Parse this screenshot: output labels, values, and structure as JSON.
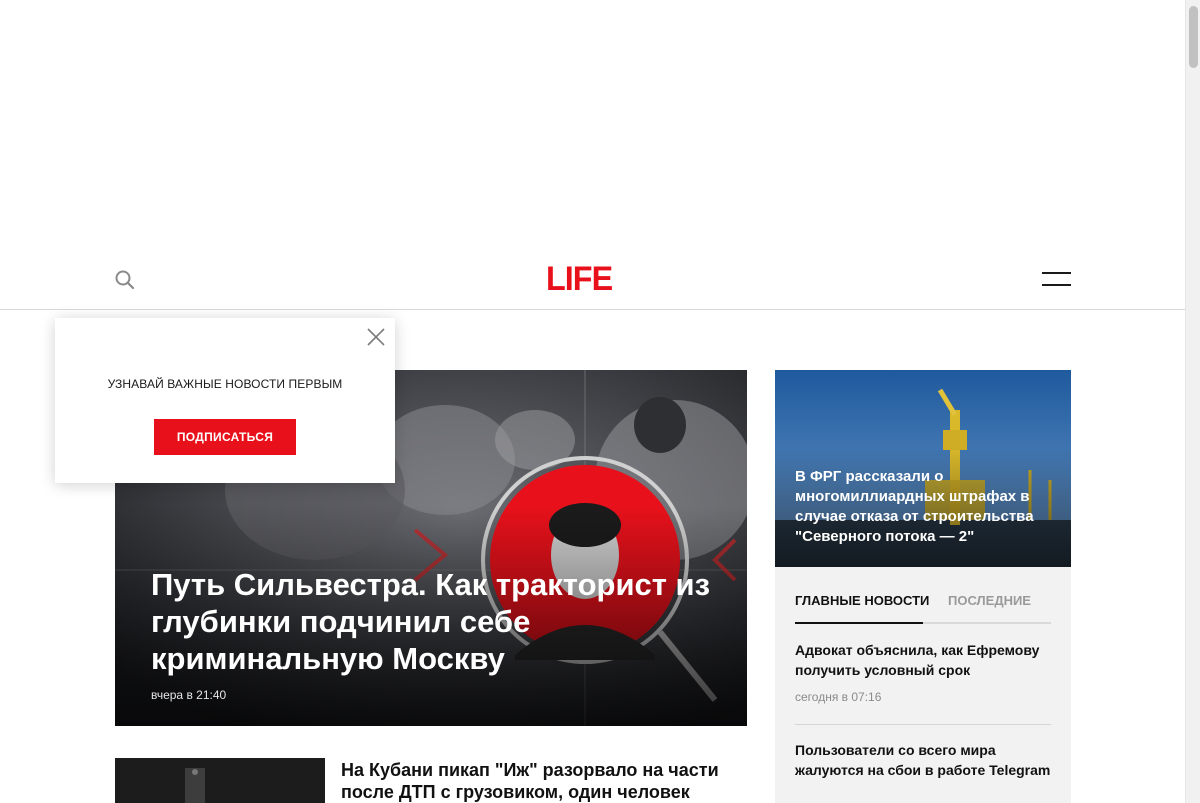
{
  "header": {
    "logo_text": "LIFE",
    "search_icon": "search-icon",
    "menu_icon": "hamburger-menu-icon"
  },
  "hero": {
    "title": "Путь Сильвестра. Как тракторист из глубинки подчинил себе криминальную Москву",
    "time": "вчера в 21:40"
  },
  "news_list": [
    {
      "title": "На Кубани пикап \"Иж\" разорвало на части после ДТП с грузовиком, один человек"
    }
  ],
  "side_card": {
    "title": "В ФРГ рассказали о многомиллиардных штрафах в случае отказа от строительства \"Северного потока — 2\""
  },
  "panel": {
    "tabs": [
      "ГЛАВНЫЕ НОВОСТИ",
      "ПОСЛЕДНИЕ"
    ],
    "items": [
      {
        "title": "Адвокат объяснила, как Ефремову получить условный срок",
        "time": "сегодня в 07:16"
      },
      {
        "title": "Пользователи со всего мира жалуются на сбои в работе Telegram",
        "time": ""
      }
    ]
  },
  "popup": {
    "text": "УЗНАВАЙ ВАЖНЫЕ НОВОСТИ ПЕРВЫМ",
    "button_label": "ПОДПИСАТЬСЯ",
    "close_icon": "close-icon"
  },
  "colors": {
    "brand_red": "#e8111b",
    "text_dark": "#111111",
    "muted": "#9a9a9a",
    "panel_bg": "#f2f2f2"
  }
}
